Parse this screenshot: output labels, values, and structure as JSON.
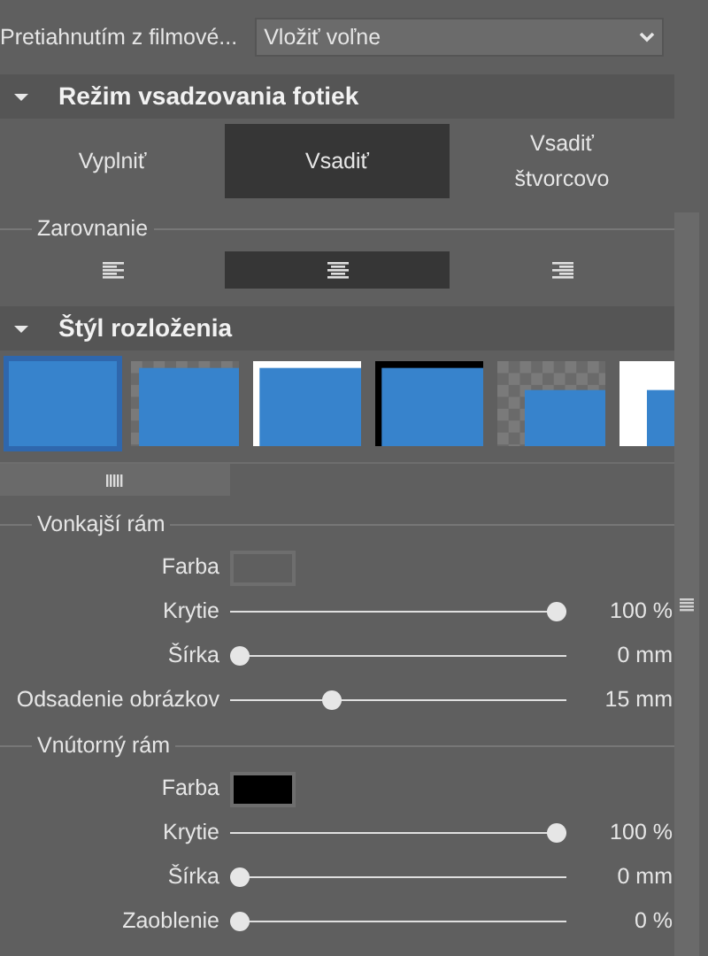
{
  "drag_from_filmstrip": {
    "label": "Pretiahnutím z filmové...",
    "value": "Vložiť voľne"
  },
  "fit_mode": {
    "title": "Režim vsadzovania fotiek",
    "expanded": true,
    "options": [
      {
        "label": "Vyplniť",
        "selected": false
      },
      {
        "label": "Vsadiť",
        "selected": true
      },
      {
        "label": "Vsadiť štvorcovo",
        "selected": false
      }
    ]
  },
  "alignment": {
    "title": "Zarovnanie",
    "options": [
      {
        "kind": "left",
        "selected": false
      },
      {
        "kind": "center",
        "selected": true
      },
      {
        "kind": "right",
        "selected": false
      }
    ]
  },
  "layout_style": {
    "title": "Štýl rozloženia",
    "expanded": true,
    "styles": [
      {
        "kind": "full",
        "selected": true
      },
      {
        "kind": "inset",
        "selected": false
      },
      {
        "kind": "white-border",
        "selected": false
      },
      {
        "kind": "black-border",
        "selected": false
      },
      {
        "kind": "small-inset",
        "selected": false
      },
      {
        "kind": "white-small",
        "selected": false
      }
    ]
  },
  "outer_frame": {
    "title": "Vonkajší rám",
    "rows": [
      {
        "kind": "color",
        "label": "Farba",
        "color": "#5f5f5f"
      },
      {
        "kind": "slider",
        "label": "Krytie",
        "level": 1,
        "reading": "100 %"
      },
      {
        "kind": "slider",
        "label": "Šírka",
        "level": 0,
        "reading": "0 mm"
      },
      {
        "kind": "slider",
        "label": "Odsadenie obrázkov",
        "level": 0.29,
        "reading": "15 mm"
      }
    ]
  },
  "inner_frame": {
    "title": "Vnútorný rám",
    "rows": [
      {
        "kind": "color",
        "label": "Farba",
        "color": "#000000"
      },
      {
        "kind": "slider",
        "label": "Krytie",
        "level": 1,
        "reading": "100 %"
      },
      {
        "kind": "slider",
        "label": "Šírka",
        "level": 0,
        "reading": "0 mm"
      },
      {
        "kind": "slider",
        "label": "Zaoblenie",
        "level": 0,
        "reading": "0 %"
      }
    ]
  }
}
